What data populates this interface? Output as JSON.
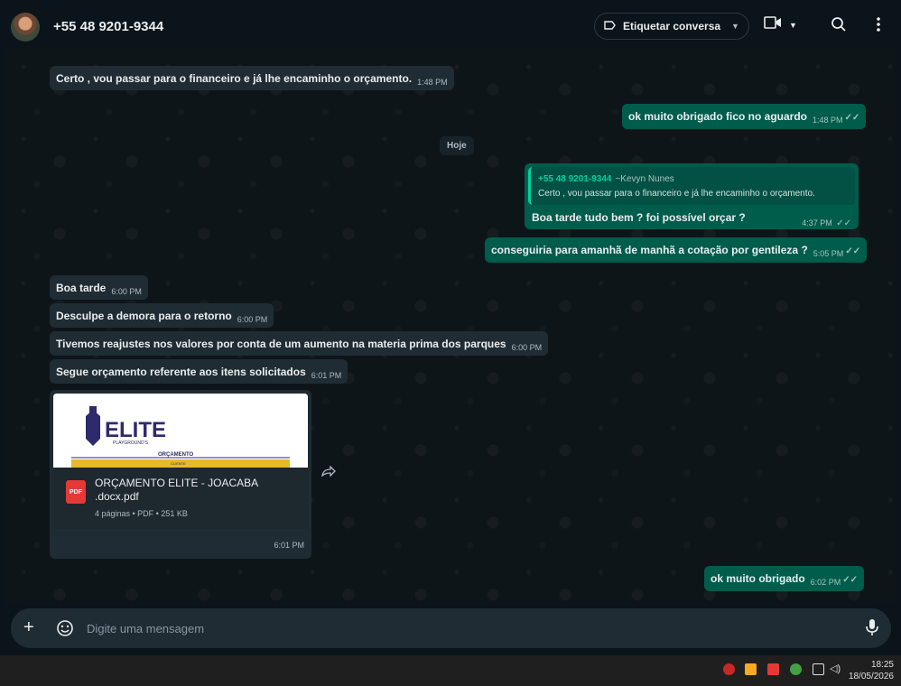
{
  "header": {
    "contact_name": "+55 48 9201-9344",
    "label_button": "Etiquetar conversa"
  },
  "messages": [
    {
      "text": "Certo , vou passar para o financeiro e já lhe encaminho o orçamento.",
      "time": "1:48 PM"
    },
    {
      "text": "ok muito obrigado fico no aguardo",
      "time": "1:48 PM"
    },
    {
      "reply_name": "+55 48 9201-9344",
      "reply_alias": "~Kevyn Nunes",
      "reply_text": "Certo , vou passar para o financeiro e já lhe encaminho o orçamento.",
      "text": "Boa tarde tudo bem ? foi possível orçar ?",
      "time": "4:37 PM"
    },
    {
      "text": "conseguiria para amanhã de manhã a cotação por gentileza ?",
      "time": "5:05 PM"
    },
    {
      "text": "Boa tarde",
      "time": "6:00 PM"
    },
    {
      "text": "Desculpe a demora para o retorno",
      "time": "6:00 PM"
    },
    {
      "text": "Tivemos reajustes nos valores por conta de um aumento na materia prima dos parques",
      "time": "6:00 PM"
    },
    {
      "text": "Segue orçamento referente aos itens solicitados",
      "time": "6:01 PM"
    },
    {
      "text": "ok muito obrigado",
      "time": "6:02 PM"
    }
  ],
  "date_divider": "Hoje",
  "document": {
    "preview_brand": "ELITE",
    "preview_sub": "PLAYGROUND'S",
    "preview_caption": "ORÇAMENTO",
    "preview_band": "CLIENTE",
    "icon_label": "PDF",
    "filename": "ORÇAMENTO ELITE - JOACABA .docx.pdf",
    "meta": "4 páginas • PDF • 251 KB",
    "time": "6:01 PM"
  },
  "composer": {
    "placeholder": "Digite uma mensagem"
  },
  "taskbar": {
    "time": "18:25",
    "date": "18/05/2026"
  },
  "colors": {
    "incoming": "#202c33",
    "outgoing": "#005c4b",
    "accent": "#06cf9c"
  }
}
